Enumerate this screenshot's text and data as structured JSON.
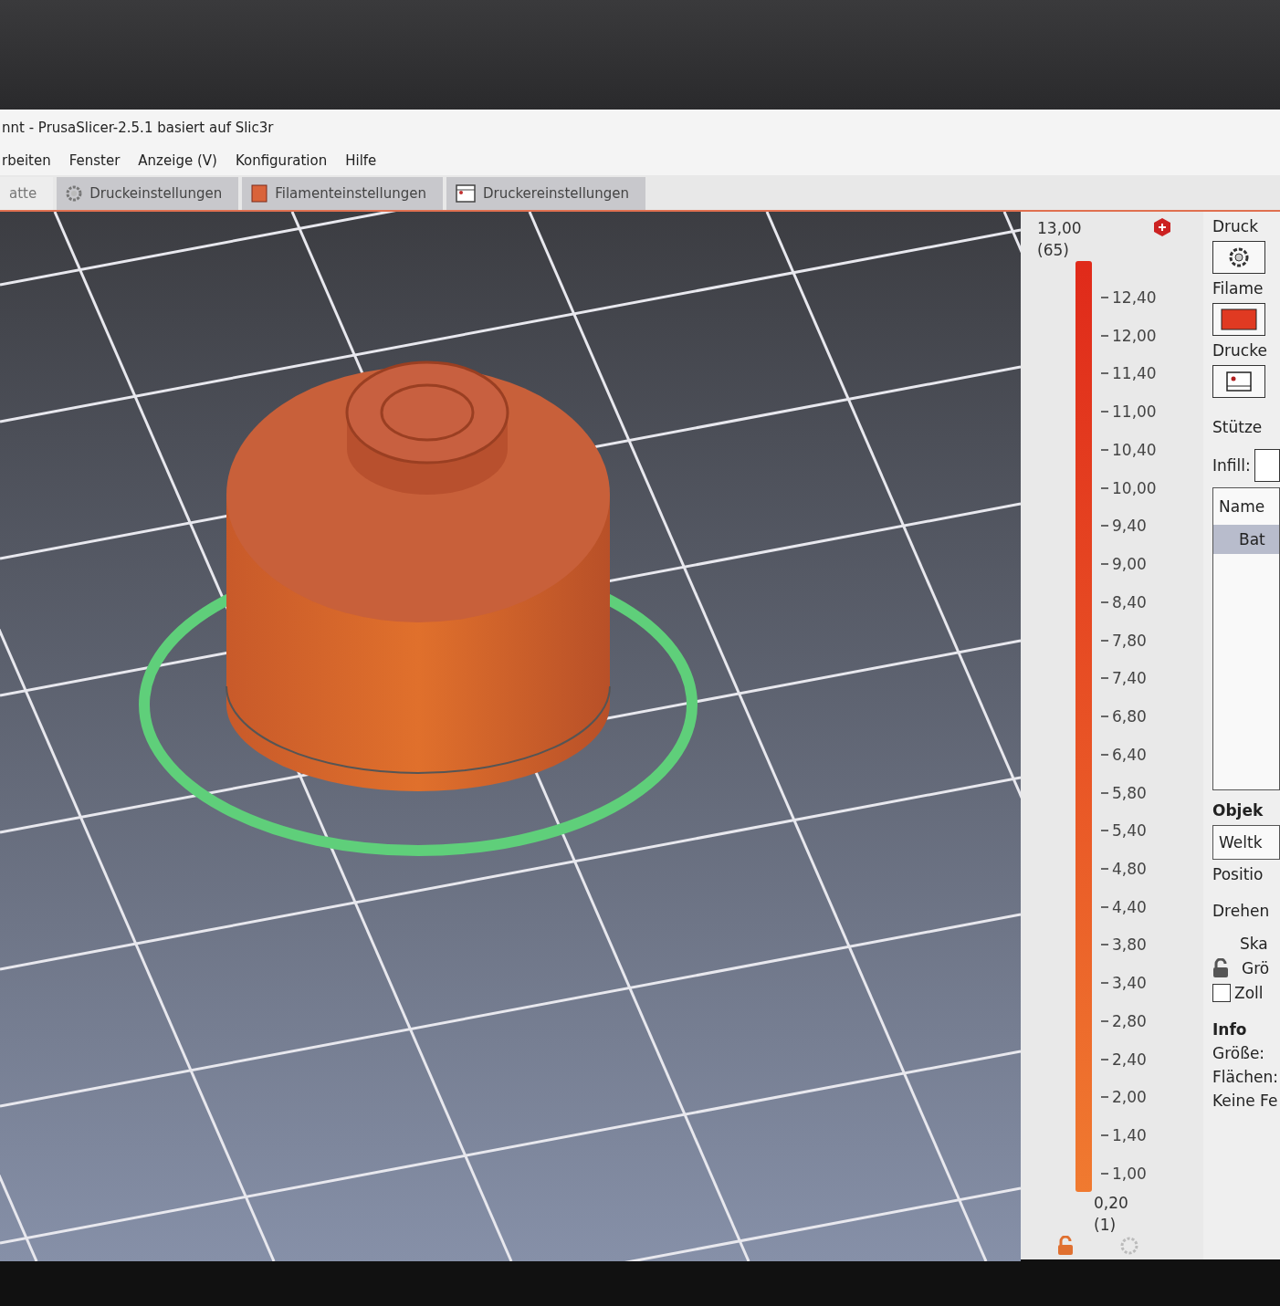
{
  "window": {
    "title": "nnt - PrusaSlicer-2.5.1 basiert auf Slic3r"
  },
  "menu": [
    "rbeiten",
    "Fenster",
    "Anzeige (V)",
    "Konfiguration",
    "Hilfe"
  ],
  "tabs": [
    {
      "label": "atte",
      "kind": "plain",
      "selected": true
    },
    {
      "label": "Druckeinstellungen",
      "kind": "print",
      "selected": false
    },
    {
      "label": "Filamenteinstellungen",
      "kind": "filament",
      "selected": false
    },
    {
      "label": "Druckereinstellungen",
      "kind": "printer",
      "selected": false
    }
  ],
  "layer_slider": {
    "top_value": "13,00",
    "top_layer": "(65)",
    "bottom_value": "0,20",
    "bottom_layer": "(1)",
    "level": 1,
    "ticks": [
      "12,40",
      "12,00",
      "11,40",
      "11,00",
      "10,40",
      "10,00",
      "9,40",
      "9,00",
      "8,40",
      "7,80",
      "7,40",
      "6,80",
      "6,40",
      "5,80",
      "5,40",
      "4,80",
      "4,40",
      "3,80",
      "3,40",
      "2,80",
      "2,40",
      "2,00",
      "1,40",
      "1,00"
    ]
  },
  "sidebar": {
    "presets": [
      {
        "label": "Druck",
        "kind": "print"
      },
      {
        "label": "Filame",
        "kind": "filament"
      },
      {
        "label": "Drucke",
        "kind": "printer"
      }
    ],
    "supports_label": "Stütze",
    "infill_label": "Infill:",
    "objects": {
      "column": "Name",
      "rows": [
        {
          "name": "Bat",
          "selected": true
        }
      ]
    },
    "object_section": "Objek",
    "coordinates": "Weltk",
    "position_label": "Positio",
    "rotate_label": "Drehen",
    "scale_label": "Ska",
    "size_label": "Grö",
    "inches": {
      "label": "Zoll",
      "checked": false
    },
    "info": {
      "title": "Info",
      "size_label": "Größe:",
      "facets_label": "Flächen:",
      "errors": "Keine Fe"
    }
  }
}
